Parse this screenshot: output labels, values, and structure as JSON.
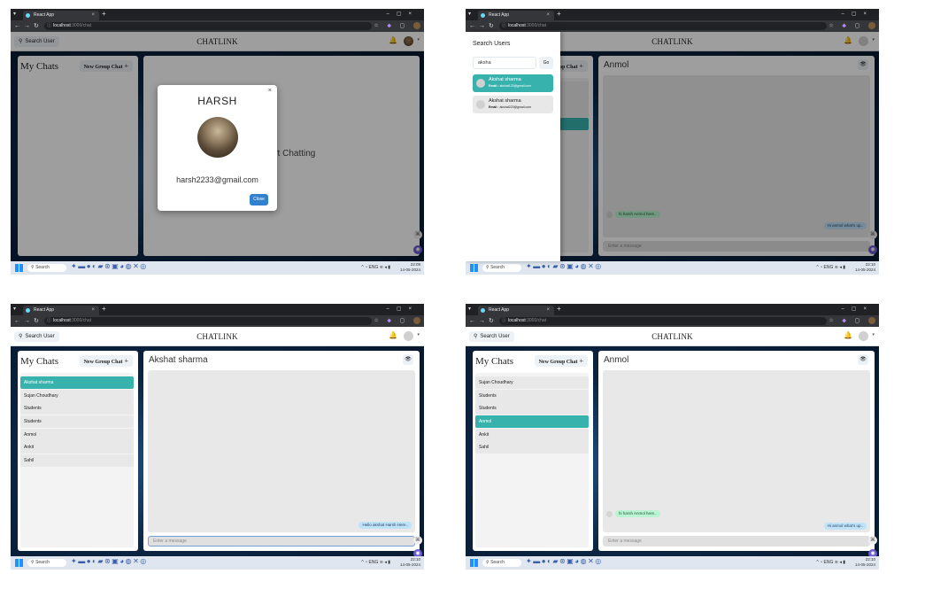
{
  "browser": {
    "tab_title": "React App",
    "url_host": "localhost",
    "url_rest": ":3000/chat"
  },
  "app": {
    "search_button": "Search User",
    "brand": "CHATLINK",
    "my_chats": "My Chats",
    "new_group_chat": "New Group Chat",
    "message_placeholder": "Enter a message"
  },
  "panel1": {
    "empty_text": "r to start Chatting",
    "modal": {
      "name": "HARSH",
      "email": "harsh2233@gmail.com",
      "close": "Close",
      "close_icon": "×"
    }
  },
  "panel2": {
    "chat_title": "Anmol",
    "drawer": {
      "title": "Search Users",
      "query": "aksha",
      "go": "Go",
      "results": [
        {
          "name": "Akshat sharma",
          "email_label": "Email :",
          "email": "akshat123@gmail.com"
        },
        {
          "name": "Akshat sharma",
          "email_label": "Email :",
          "email": "akshat223@gmail.com"
        }
      ]
    },
    "messages": {
      "in": "hi harsh Anmol here..",
      "out": "Hi anmol what's up.."
    }
  },
  "panel3": {
    "chat_title": "Akshat sharma",
    "chats": [
      "Akshat sharma",
      "Sujan Choudhary",
      "Students",
      "Students",
      "Anmol",
      "Ankit",
      "Sahil"
    ],
    "selected_index": 0,
    "messages": {
      "out": "Hello akshat Harsh Here.."
    }
  },
  "panel4": {
    "chat_title": "Anmol",
    "chats": [
      "Sujan Choudhary",
      "Students",
      "Students",
      "Anmol",
      "Ankit",
      "Sahil"
    ],
    "selected_index": 3,
    "messages": {
      "in": "hi harsh Anmol here..",
      "out": "Hi anmol what's up.."
    }
  },
  "taskbar": {
    "search": "Search",
    "lang": "ENG",
    "region": "IN",
    "time_p1": "22:09",
    "time_other": "22:10",
    "date": "14-05-2024"
  },
  "colors": {
    "accent": "#38b2ac",
    "modal_button": "#3182ce",
    "bubble_out": "#bee3f8",
    "bubble_in": "#b9f5d0"
  }
}
